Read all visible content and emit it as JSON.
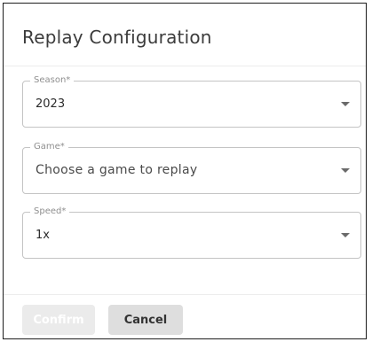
{
  "dialog": {
    "title": "Replay Configuration"
  },
  "fields": {
    "season": {
      "label": "Season*",
      "value": "2023"
    },
    "game": {
      "label": "Game*",
      "placeholder": "Choose a game to replay"
    },
    "speed": {
      "label": "Speed*",
      "value": "1x"
    }
  },
  "actions": {
    "confirm_label": "Confirm",
    "cancel_label": "Cancel"
  },
  "colors": {
    "field_border": "#c4c4c4",
    "confirm_disabled_bg": "#ebebeb",
    "cancel_bg": "#dedede"
  },
  "icons": {
    "dropdown": "caret-down-icon"
  }
}
